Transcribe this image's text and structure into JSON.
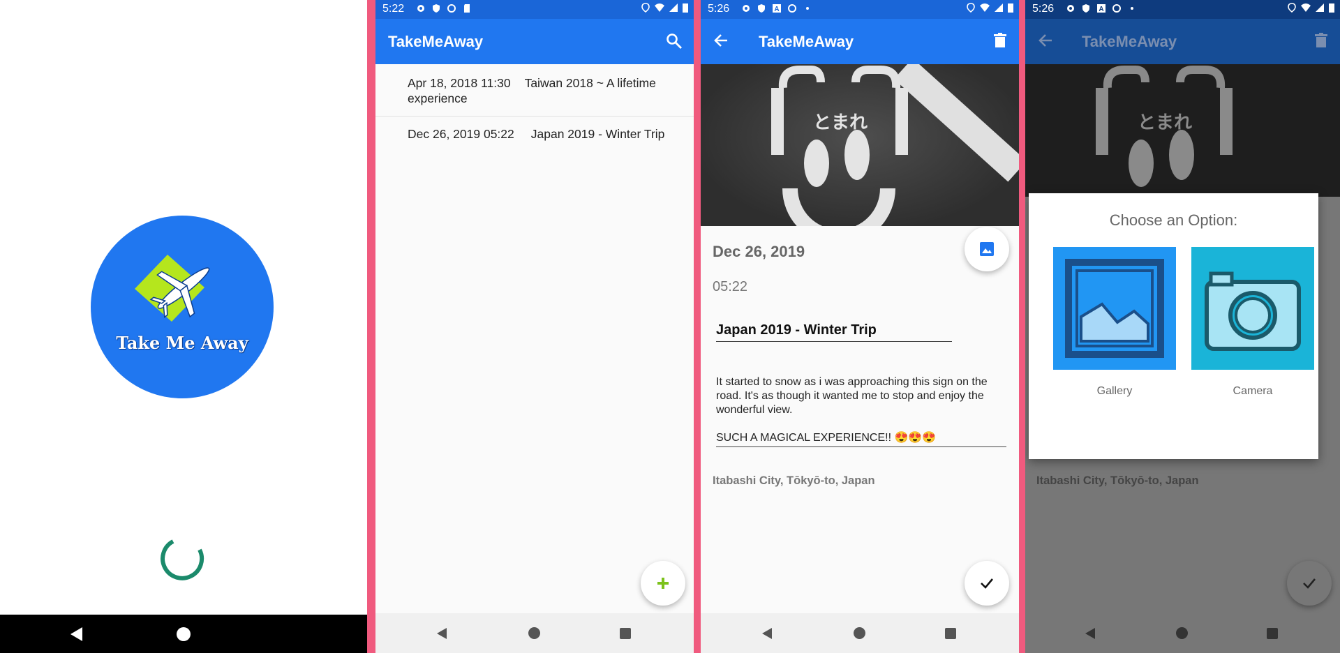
{
  "colors": {
    "primary": "#2077f0",
    "status_bar": "#1a66d8",
    "divider": "#f05a7e",
    "fab_plus": "#7cc21c",
    "spinner": "#1b8a6b",
    "logo_green": "#b5e61d"
  },
  "splash": {
    "logo_text": "Take Me Away"
  },
  "list_screen": {
    "status_time": "5:22",
    "app_title": "TakeMeAway",
    "entries": [
      {
        "date": "Apr 18, 2018 11:30",
        "title": "Taiwan 2018 ~ A lifetime experience"
      },
      {
        "date": "Dec 26, 2019 05:22",
        "title": "Japan 2019 - Winter Trip"
      }
    ],
    "fab_icon": "plus-icon"
  },
  "detail_screen": {
    "status_time": "5:26",
    "app_title": "TakeMeAway",
    "date": "Dec 26, 2019",
    "time": "05:22",
    "title": "Japan 2019 - Winter Trip",
    "body": "It started to snow as i was approaching this sign on the road. It's as though it wanted me to stop and enjoy the wonderful view.",
    "body_last": "SUCH A MAGICAL EXPERIENCE!! 😍😍😍",
    "location": "Itabashi City, Tōkyō-to, Japan",
    "photo_text": "とまれ"
  },
  "dialog_screen": {
    "status_time": "5:26",
    "app_title": "TakeMeAway",
    "location": "Itabashi City, Tōkyō-to, Japan",
    "dialog_title": "Choose an Option:",
    "option_gallery": "Gallery",
    "option_camera": "Camera",
    "photo_text": "とまれ"
  }
}
